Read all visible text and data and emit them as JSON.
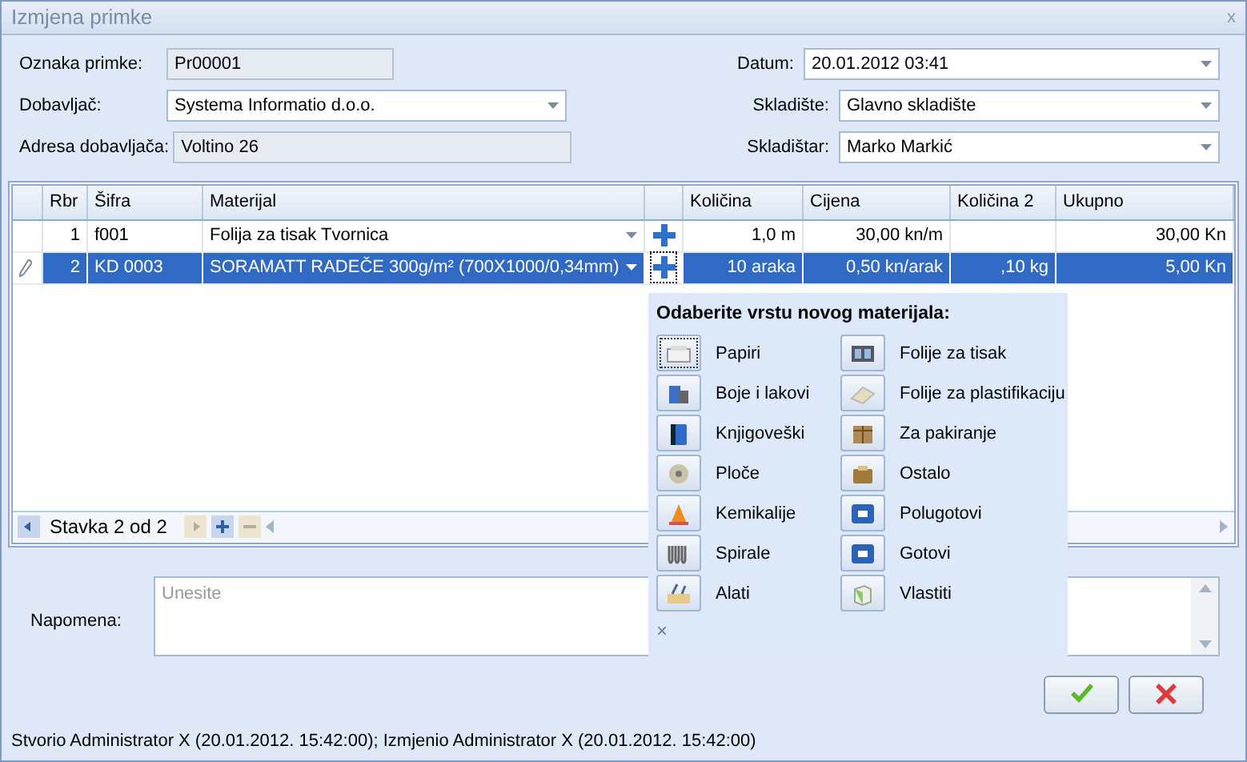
{
  "window": {
    "title": "Izmjena primke",
    "close": "x"
  },
  "form": {
    "left": [
      {
        "label": "Oznaka primke:",
        "value": "Pr00001",
        "kind": "readonly"
      },
      {
        "label": "Dobavljač:",
        "value": "Systema Informatio d.o.o.",
        "kind": "combo"
      },
      {
        "label": "Adresa dobavljača:",
        "value": "Voltino 26",
        "kind": "readonly"
      }
    ],
    "right": [
      {
        "label": "Datum:",
        "value": "20.01.2012 03:41",
        "kind": "combo"
      },
      {
        "label": "Skladište:",
        "value": "Glavno skladište",
        "kind": "combo"
      },
      {
        "label": "Skladištar:",
        "value": "Marko Markić",
        "kind": "combo"
      }
    ]
  },
  "grid": {
    "columns": [
      "Rbr",
      "Šifra",
      "Materijal",
      "Količina",
      "Cijena",
      "Količina 2",
      "Ukupno"
    ],
    "rows": [
      {
        "rbr": "1",
        "sifra": "f001",
        "materijal": "Folija za tisak Tvornica",
        "kolicina": "1,0 m",
        "cijena": "30,00 kn/m",
        "ukupno": "30,00 Kn",
        "selected": false,
        "editing": false
      },
      {
        "rbr": "2",
        "sifra": "KD 0003",
        "materijal": "SORAMATT RADEČE 300g/m² (700X1000/0,34mm)",
        "kolicina": "10 araka",
        "cijena": "0,50 kn/arak",
        "kolicina_2": ",10 kg",
        "ukupno": "5,00 Kn",
        "selected": true,
        "editing": true
      }
    ],
    "navigator": {
      "text": "Stavka 2 od 2",
      "buttons": [
        {
          "kind": "prev",
          "disabled": false
        },
        {
          "kind": "next",
          "disabled": true
        },
        {
          "kind": "add",
          "disabled": false
        },
        {
          "kind": "remove",
          "disabled": true
        }
      ]
    }
  },
  "popup": {
    "title": "Odaberite vrstu novog materijala:",
    "close": "×",
    "items": [
      {
        "label": "Papiri",
        "focused": true
      },
      {
        "label": "Folije za tisak",
        "focused": false
      },
      {
        "label": "Boje i lakovi",
        "focused": false
      },
      {
        "label": "Folije za plastifikaciju",
        "focused": false
      },
      {
        "label": "Knjigoveški",
        "focused": false
      },
      {
        "label": "Za pakiranje",
        "focused": false
      },
      {
        "label": "Ploče",
        "focused": false
      },
      {
        "label": "Ostalo",
        "focused": false
      },
      {
        "label": "Kemikalije",
        "focused": false
      },
      {
        "label": "Polugotovi",
        "focused": false
      },
      {
        "label": "Spirale",
        "focused": false
      },
      {
        "label": "Gotovi",
        "focused": false
      },
      {
        "label": "Alati",
        "focused": false
      },
      {
        "label": "Vlastiti",
        "focused": false
      }
    ]
  },
  "notes": {
    "label": "Napomena:",
    "placeholder": "Unesite"
  },
  "buttons": [
    {
      "kind": "ok"
    },
    {
      "kind": "cancel"
    }
  ],
  "status": "Stvorio Administrator X (20.01.2012. 15:42:00); Izmjenio Administrator X (20.01.2012. 15:42:00)"
}
